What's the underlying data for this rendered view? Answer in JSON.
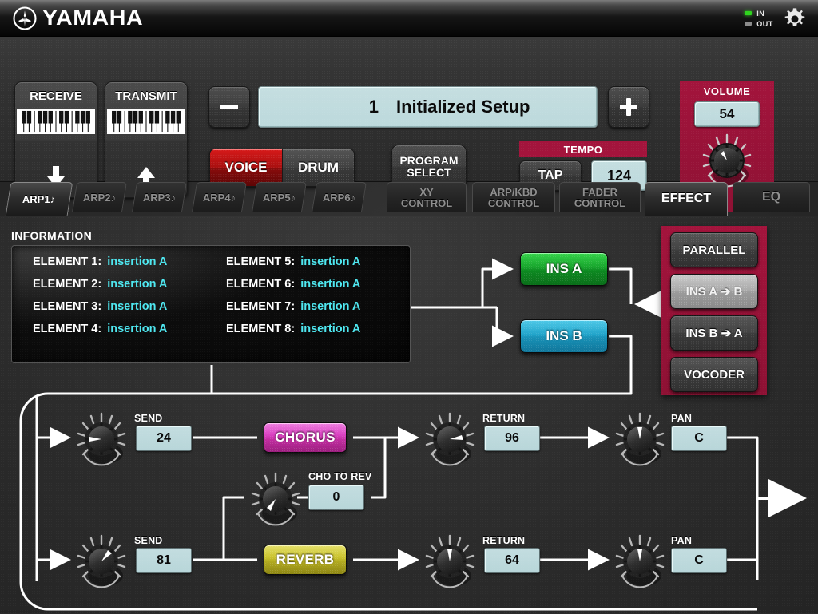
{
  "header": {
    "brand": "YAMAHA",
    "brand_icon": "yamaha-tuning-fork-icon",
    "io": [
      {
        "label": "IN",
        "state": "on",
        "color": "#2fd41e"
      },
      {
        "label": "OUT",
        "state": "off",
        "color": "#8c8c8c"
      }
    ],
    "settings_icon": "gear-icon"
  },
  "panel": {
    "receive": {
      "label": "RECEIVE",
      "icon": "keyboard-icon",
      "arrow": "arrow-down-icon"
    },
    "transmit": {
      "label": "TRANSMIT",
      "icon": "keyboard-icon",
      "arrow": "arrow-up-icon"
    },
    "minus_label": "–",
    "plus_label": "+",
    "program": {
      "number": "1",
      "name": "Initialized Setup"
    },
    "voice_label": "VOICE",
    "drum_label": "DRUM",
    "voice_drum_selected": "VOICE",
    "program_select_line1": "PROGRAM",
    "program_select_line2": "SELECT",
    "tempo": {
      "header": "TEMPO",
      "tap_label": "TAP",
      "value": "124"
    },
    "volume": {
      "label": "VOLUME",
      "value": "54"
    }
  },
  "tabs": {
    "active": "EFFECT",
    "arp": [
      {
        "label": "ARP1",
        "note": "♪",
        "active": true
      },
      {
        "label": "ARP2",
        "note": "♪",
        "active": false
      },
      {
        "label": "ARP3",
        "note": "♪",
        "active": false
      },
      {
        "label": "ARP4",
        "note": "♪",
        "active": false
      },
      {
        "label": "ARP5",
        "note": "♪",
        "active": false
      },
      {
        "label": "ARP6",
        "note": "♪",
        "active": false
      }
    ],
    "main": [
      {
        "line1": "XY",
        "line2": "CONTROL",
        "active": false
      },
      {
        "line1": "ARP/KBD",
        "line2": "CONTROL",
        "active": false
      },
      {
        "line1": "FADER",
        "line2": "CONTROL",
        "active": false
      },
      {
        "line1": "EFFECT",
        "line2": "",
        "active": true
      },
      {
        "line1": "EQ",
        "line2": "",
        "active": false
      }
    ]
  },
  "effect": {
    "information_title": "INFORMATION",
    "elements": [
      {
        "key": "ELEMENT 1:",
        "value": "insertion A"
      },
      {
        "key": "ELEMENT 5:",
        "value": "insertion A"
      },
      {
        "key": "ELEMENT 2:",
        "value": "insertion A"
      },
      {
        "key": "ELEMENT 6:",
        "value": "insertion A"
      },
      {
        "key": "ELEMENT 3:",
        "value": "insertion A"
      },
      {
        "key": "ELEMENT 7:",
        "value": "insertion A"
      },
      {
        "key": "ELEMENT 4:",
        "value": "insertion A"
      },
      {
        "key": "ELEMENT 8:",
        "value": "insertion A"
      }
    ],
    "ins_a_label": "INS A",
    "ins_b_label": "INS B",
    "routing": {
      "selected": "INS A ➔ B",
      "buttons": [
        {
          "label": "PARALLEL",
          "selected": false
        },
        {
          "label": "INS A ➔ B",
          "selected": true
        },
        {
          "label": "INS B ➔ A",
          "selected": false
        },
        {
          "label": "VOCODER",
          "selected": false
        }
      ]
    },
    "chorus": {
      "name": "CHORUS",
      "send_label": "SEND",
      "send_value": "24",
      "return_label": "RETURN",
      "return_value": "96",
      "pan_label": "PAN",
      "pan_value": "C"
    },
    "reverb": {
      "name": "REVERB",
      "send_label": "SEND",
      "send_value": "81",
      "return_label": "RETURN",
      "return_value": "64",
      "pan_label": "PAN",
      "pan_value": "C"
    },
    "cho_to_rev": {
      "label": "CHO TO REV",
      "value": "0"
    }
  },
  "colors": {
    "accent_red": "#a3143c",
    "lcd": "#c0dadd",
    "info_value": "#4ee7f0",
    "ins_a": "#17a42c",
    "ins_b": "#21a4ca",
    "chorus": "#d93fc0",
    "reverb": "#c9c22c",
    "led_on": "#2fd41e"
  }
}
